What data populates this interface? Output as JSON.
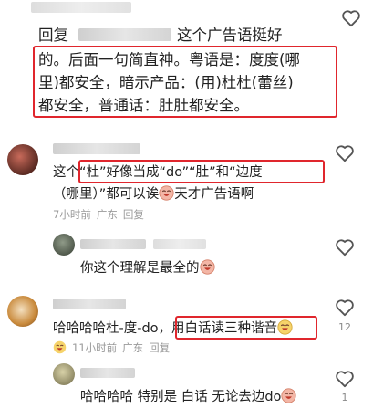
{
  "comment1": {
    "reply_prefix": "回复",
    "line1_tail": "这个广告语挺好",
    "line2": "的。后面一句简直神。粤语是：度度(哪",
    "line3": "里)都安全，暗示产品：(用)杜杜(蕾丝)",
    "line4": "都安全，普通话：肚肚都安全。"
  },
  "comment2": {
    "line1": "这个“杜”好像当成“do”“肚”和“边度",
    "line2_a": "（哪里）”都可以诶",
    "line2_b": "天才广告语啊",
    "meta": {
      "time": "7小时前",
      "location": "广东",
      "reply": "回复"
    }
  },
  "reply1": {
    "text": "你这个理解是最全的"
  },
  "comment3": {
    "text_a": "哈哈哈哈杜-度-do，",
    "text_b": "用白话读三种谐音",
    "meta": {
      "time": "11小时前",
      "location": "广东",
      "reply": "回复"
    },
    "likes": "12"
  },
  "reply2": {
    "text": "哈哈哈哈 特别是 白话 无论去边do",
    "likes": "1"
  },
  "colors": {
    "highlight": "#e0262d",
    "meta": "#9a9a9a",
    "text": "#222222"
  },
  "icons": [
    "heart-outline-icon",
    "laughing-emoji-icon",
    "avatar-image"
  ]
}
